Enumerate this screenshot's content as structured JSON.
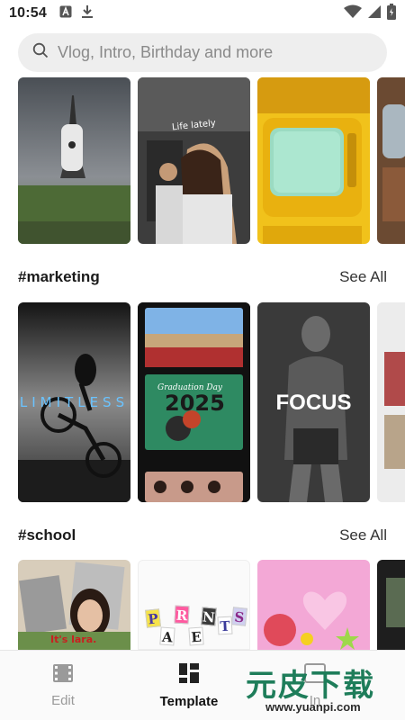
{
  "status_bar": {
    "time": "10:54"
  },
  "search": {
    "placeholder": "Vlog, Intro, Birthday and more"
  },
  "sections": [
    {
      "title": "#marketing",
      "see_all": "See All"
    },
    {
      "title": "#school",
      "see_all": "See All"
    }
  ],
  "templates": {
    "row1_thumb2_text": "Life lately",
    "marketing_thumb1_text": "LIMITLESS",
    "marketing_thumb2_caption": "Graduation Day",
    "marketing_thumb2_year": "2025",
    "marketing_thumb3_text": "FOCUS",
    "school_thumb1_text": "It's lara.",
    "school_thumb2_letters": [
      "P",
      "A",
      "R",
      "E",
      "N",
      "T",
      "S"
    ]
  },
  "bottom_nav": {
    "items": [
      {
        "label": "Edit",
        "icon": "film-icon",
        "active": false
      },
      {
        "label": "Template",
        "icon": "grid-icon",
        "active": true
      },
      {
        "label": "In",
        "icon": "inbox-icon",
        "active": false
      }
    ]
  },
  "watermark": {
    "text_cn": "元皮下载",
    "url": "www.yuanpi.com"
  },
  "colors": {
    "accent_green": "#1e7d5a",
    "search_bg": "#eeeeee",
    "active_nav": "#111111"
  }
}
